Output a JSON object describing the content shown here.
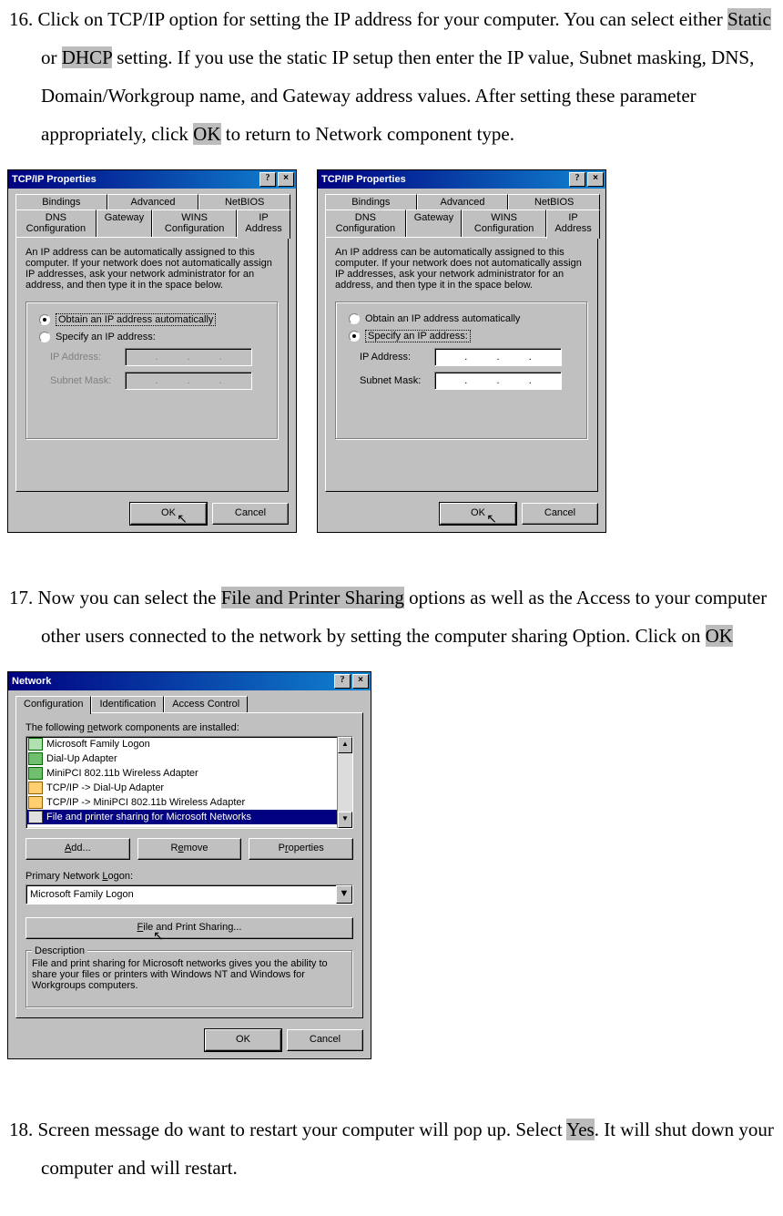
{
  "step16": {
    "number": "16.",
    "text_p1": "Click on TCP/IP option for setting the IP address for your computer. You can select either ",
    "hl_static": "Static",
    "text_p2": " or ",
    "hl_dhcp": "DHCP",
    "text_p3": " setting. If you use the static IP setup then enter the IP value, Subnet masking, DNS, Domain/Workgroup name, and Gateway address values.    After setting these parameter appropriately, click ",
    "hl_ok": "OK",
    "text_p4": " to return to Network component type."
  },
  "tcpip_dialog": {
    "title": "TCP/IP Properties",
    "help_glyph": "?",
    "close_glyph": "×",
    "tabs_row1": {
      "bindings": "Bindings",
      "advanced": "Advanced",
      "netbios": "NetBIOS"
    },
    "tabs_row2": {
      "dns": "DNS Configuration",
      "gateway": "Gateway",
      "wins": "WINS Configuration",
      "ip": "IP Address"
    },
    "info": "An IP address can be automatically assigned to this computer. If your network does not automatically assign IP addresses, ask your network administrator for an address, and then type it in the space below.",
    "radio_obtain": "Obtain an IP address automatically",
    "radio_specify": "Specify an IP address:",
    "ip_label": "IP Address:",
    "subnet_label": "Subnet Mask:",
    "dot": ".",
    "ok": "OK",
    "cancel": "Cancel"
  },
  "step17": {
    "number": "17.",
    "text_p1": "Now you can select the ",
    "hl_fps": "File and Printer Sharing",
    "text_p2": " options as well as the Access to your computer other users connected to the network by setting the computer sharing Option.    Click on ",
    "hl_ok": "OK"
  },
  "network_dialog": {
    "title": "Network",
    "help_glyph": "?",
    "close_glyph": "×",
    "tabs": {
      "config": "Configuration",
      "ident": "Identification",
      "access": "Access Control"
    },
    "components_label_u": "n",
    "components_label": "The following network components are installed:",
    "list": [
      {
        "type": "client",
        "text": "Microsoft Family Logon",
        "sel": false
      },
      {
        "type": "adapter",
        "text": "Dial-Up Adapter",
        "sel": false
      },
      {
        "type": "adapter",
        "text": "MiniPCI 802.11b Wireless Adapter",
        "sel": false
      },
      {
        "type": "proto",
        "text": "TCP/IP -> Dial-Up Adapter",
        "sel": false
      },
      {
        "type": "proto",
        "text": "TCP/IP -> MiniPCI 802.11b Wireless Adapter",
        "sel": false
      },
      {
        "type": "service",
        "text": "File and printer sharing for Microsoft Networks",
        "sel": true
      }
    ],
    "btn_add_u": "A",
    "btn_add": "dd...",
    "btn_remove_u": "e",
    "btn_remove_pre": "R",
    "btn_remove_post": "move",
    "btn_props_u": "r",
    "btn_props_pre": "P",
    "btn_props_post": "operties",
    "primary_logon_label": "Primary Network Logon:",
    "primary_logon_u": "L",
    "primary_logon_value": "Microsoft Family Logon",
    "fps_btn_u": "F",
    "fps_btn": "ile and Print Sharing...",
    "desc_title": "Description",
    "desc_text": "File and print sharing for Microsoft networks gives you the ability to share your files or printers with Windows NT and Windows for Workgroups computers.",
    "ok": "OK",
    "cancel": "Cancel",
    "arrow_up": "▲",
    "arrow_down": "▼",
    "combo_arrow": "▼"
  },
  "step18": {
    "number": "18.",
    "text_p1": "Screen message do want to restart your computer will pop up.    Select ",
    "hl_yes": "Yes",
    "text_p2": ". It will shut down your computer and will restart."
  },
  "cursor_glyph": "↖"
}
